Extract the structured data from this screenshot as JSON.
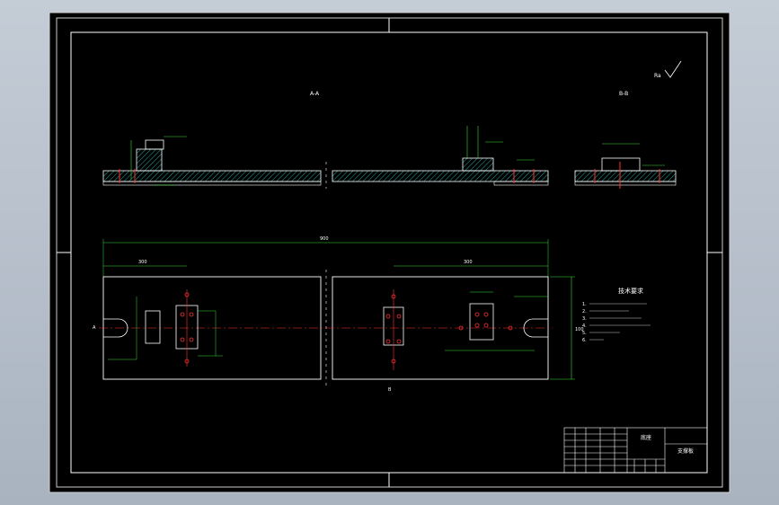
{
  "sheet": {
    "background": "#000000",
    "line_color": "#ffffff",
    "accent_green": "#35e035",
    "accent_red": "#ff3030",
    "hatch_cyan": "#2fd0c8"
  },
  "section_labels": {
    "left": "A-A",
    "middle": "B-B",
    "roughness": "Ra"
  },
  "notes": {
    "title": "技术要求",
    "lines": [
      "1.",
      "2.",
      "3.",
      "4.",
      "5.",
      "6."
    ]
  },
  "title_block": {
    "name": "底座",
    "drawing_no": "支撑板"
  },
  "dimensions": {
    "overall": "900",
    "left_span": "300",
    "right_span": "300",
    "height": "100"
  }
}
